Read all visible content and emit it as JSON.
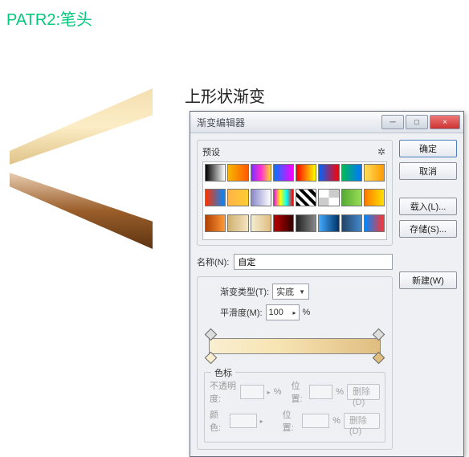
{
  "page": {
    "title": "PATR2:笔头",
    "section_label": "上形状渐变"
  },
  "dialog": {
    "title": "渐变编辑器",
    "win": {
      "min": "─",
      "max": "□",
      "close": "×"
    },
    "buttons": {
      "ok": "确定",
      "cancel": "取消",
      "load": "载入(L)...",
      "save": "存储(S)...",
      "new": "新建(W)"
    },
    "presets": {
      "label": "预设",
      "gear": "✲"
    },
    "name": {
      "label": "名称(N):",
      "value": "自定"
    },
    "gradient": {
      "type_label": "渐变类型(T):",
      "type_value": "实底",
      "smooth_label": "平滑度(M):",
      "smooth_value": "100",
      "percent": "%"
    },
    "stops": {
      "legend": "色标",
      "opacity_label": "不透明度:",
      "position_label": "位置:",
      "delete_label": "删除(D)",
      "color_label": "颜色:",
      "percent": "%"
    }
  },
  "swatches": [
    "linear-gradient(90deg,#000,#fff)",
    "linear-gradient(90deg,#f7b500,#ff5a00)",
    "linear-gradient(90deg,#7b2fff,#ff2fd1,#ffd92f)",
    "linear-gradient(90deg,#07f,#f0f)",
    "linear-gradient(90deg,#f00,#ff0)",
    "linear-gradient(90deg,#06f,#f00)",
    "linear-gradient(90deg,#0b5,#07f)",
    "linear-gradient(90deg,#ffde5a,#ff9a00)",
    "linear-gradient(90deg,#f30,#08f)",
    "linear-gradient(90deg,#ffb347,#ffcc33)",
    "linear-gradient(90deg,#8888cc,#fff)",
    "linear-gradient(90deg,#f0f,#ff0,#0ff,#f00)",
    "repeating-linear-gradient(45deg,#000 0 4px,#fff 4px 8px)",
    "repeating-conic-gradient(#ccc 0 25%,#fff 0 50%)",
    "linear-gradient(90deg,#5a3,#9d5)",
    "linear-gradient(90deg,#ff7a00,#ffe000)",
    "linear-gradient(90deg,#b04000,#ff9a3a)",
    "linear-gradient(90deg,#d0b070,#f4e4c0)",
    "linear-gradient(90deg,#f4eed0,#e0bd80)",
    "linear-gradient(90deg,#b00,#300)",
    "linear-gradient(90deg,#222,#888)",
    "linear-gradient(90deg,#4af,#036)",
    "linear-gradient(90deg,#246,#48c)",
    "linear-gradient(90deg,#08f,#f33)"
  ]
}
